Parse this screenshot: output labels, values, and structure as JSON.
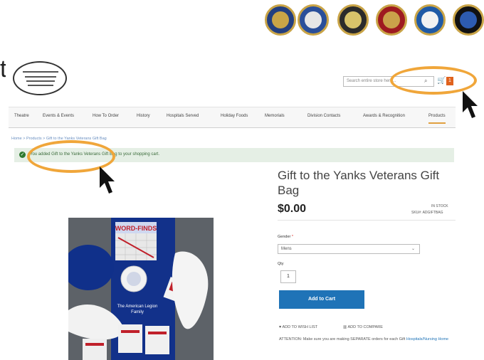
{
  "header": {
    "search_placeholder": "Search entire store here...",
    "cart_count": "1"
  },
  "nav": {
    "items": [
      "Theatre",
      "Events & Events",
      "How To Order",
      "History",
      "Hospitals Served",
      "Holiday Foods",
      "Memorials",
      "Division Contacts",
      "Awards & Recognition",
      "Products"
    ]
  },
  "breadcrumb": "Home  >  Products  >  Gift to the Yanks Veterans Gift Bag",
  "message": "You added Gift to the Yanks Veterans Gift Bag to your shopping cart.",
  "product": {
    "title": "Gift to the Yanks Veterans Gift Bag",
    "price": "$0.00",
    "stock": "IN STOCK",
    "sku": "SKU#:  ADGIFTBAG",
    "option_label": "Gender",
    "option_required": "*",
    "option_value": "Mens",
    "qty_label": "Qty",
    "qty_value": "1",
    "add_to_cart": "Add to Cart",
    "wishlist": "ADD TO WISH LIST",
    "compare": "ADD TO COMPARE",
    "attention": "ATTENTION: Make sure you are making SEPARATE orders for each Gift",
    "attention_link": "Hospitals/Nursing Home"
  },
  "colors": {
    "seal_blue": "#1f3d7a",
    "seal_gold": "#c9a447",
    "accent_orange": "#f0a63a",
    "button_blue": "#1f73b7",
    "success_bg": "#e5efe5"
  }
}
